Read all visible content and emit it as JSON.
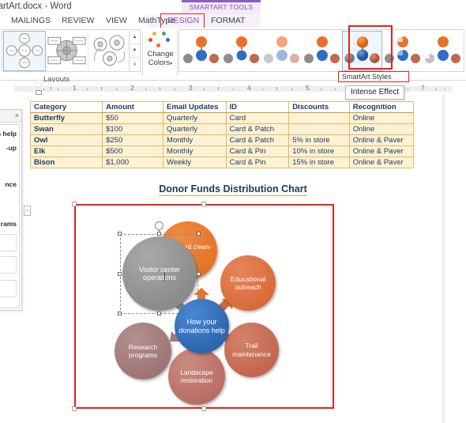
{
  "window": {
    "title": "martArt.docx - Word",
    "contextual_tools_label": "SMARTART TOOLS"
  },
  "tabs": [
    {
      "label": "MAILINGS",
      "active": false
    },
    {
      "label": "REVIEW",
      "active": false
    },
    {
      "label": "VIEW",
      "active": false
    },
    {
      "label": "MathType",
      "active": false
    },
    {
      "label": "DESIGN",
      "active": true
    },
    {
      "label": "FORMAT",
      "active": false
    }
  ],
  "ribbon": {
    "layouts_group_label": "Layouts",
    "change_colors_label_line1": "Change",
    "change_colors_label_line2": "Colors",
    "change_colors_caret": "▾",
    "scroll_up": "▲",
    "scroll_down": "▼",
    "scroll_more": "≡",
    "styles_group_label": "SmartArt Styles",
    "tooltip": "Intense Effect",
    "selected_style_index": 4
  },
  "ruler": {
    "marks": [
      "1",
      "2",
      "3",
      "4",
      "5",
      "7"
    ]
  },
  "table": {
    "headers": [
      "Category",
      "Amount",
      "Email Updates",
      "ID",
      "Discounts",
      "Recognition"
    ],
    "rows": [
      [
        "Butterfly",
        "$50",
        "Quarterly",
        "Card",
        "",
        "Online"
      ],
      [
        "Swan",
        "$100",
        "Quarterly",
        "Card & Patch",
        "",
        "Online"
      ],
      [
        "Owl",
        "$250",
        "Monthly",
        "Card & Patch",
        "5% in store",
        "Online & Paver"
      ],
      [
        "Elk",
        "$500",
        "Monthly",
        "Card & Pin",
        "10% in store",
        "Online & Paver"
      ],
      [
        "Bison",
        "$1,000",
        "Weekly",
        "Card & Pin",
        "15% in store",
        "Online & Paver"
      ]
    ]
  },
  "chart_data": {
    "type": "diagram",
    "title": "Donor Funds Distribution Chart",
    "center": {
      "label": "How your donations help",
      "color": "#2e6fc4"
    },
    "nodes": [
      {
        "label": "Riverbed clean-up",
        "color": "#e8722a"
      },
      {
        "label": "Educational outreach",
        "color": "#dd6f3d"
      },
      {
        "label": "Trail maintenance",
        "color": "#c66a54"
      },
      {
        "label": "Landscape restoration",
        "color": "#bd7068"
      },
      {
        "label": "Research programs",
        "color": "#a3797c"
      },
      {
        "label": "Visitor center operations",
        "color": "#8f8f8f",
        "selected": true
      }
    ]
  },
  "text_pane": {
    "close_label": "×",
    "lines": [
      "s help",
      "-up",
      "nce",
      "rams"
    ],
    "expand_arrow": "›"
  }
}
